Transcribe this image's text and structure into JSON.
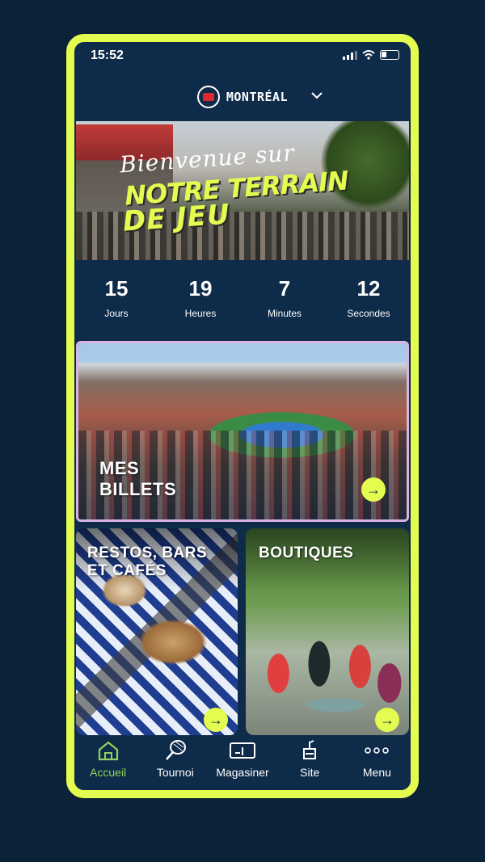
{
  "status_bar": {
    "time": "15:52"
  },
  "location": {
    "city": "MONTRÉAL"
  },
  "hero": {
    "line1": "Bienvenue sur",
    "line2": "NOTRE TERRAIN",
    "line3": "DE JEU"
  },
  "countdown": [
    {
      "value": "15",
      "label": "Jours"
    },
    {
      "value": "19",
      "label": "Heures"
    },
    {
      "value": "7",
      "label": "Minutes"
    },
    {
      "value": "12",
      "label": "Secondes"
    }
  ],
  "cards": {
    "tickets": {
      "line1": "MES",
      "line2": "BILLETS"
    },
    "food": {
      "line1": "RESTOS, BARS",
      "line2": "ET CAFÉS"
    },
    "shop": {
      "title": "BOUTIQUES"
    }
  },
  "tabs": [
    {
      "label": "Accueil",
      "icon": "home-icon",
      "active": true
    },
    {
      "label": "Tournoi",
      "icon": "tennis-racket-icon"
    },
    {
      "label": "Magasiner",
      "icon": "ticket-icon"
    },
    {
      "label": "Site",
      "icon": "cup-icon"
    },
    {
      "label": "Menu",
      "icon": "more-dots-icon"
    }
  ],
  "colors": {
    "accent": "#e4fb4f",
    "background": "#0e2b4a",
    "active_tab": "#8fd35a",
    "highlight_border": "#d9b3e6"
  }
}
